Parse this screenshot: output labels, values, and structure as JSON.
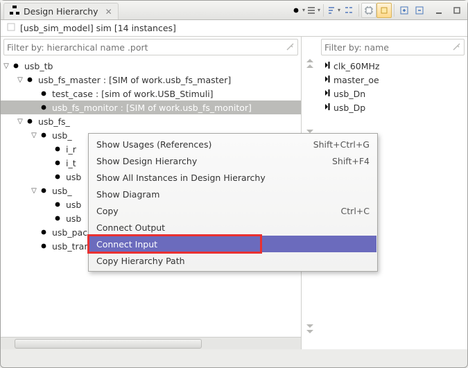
{
  "tab": {
    "title": "Design Hierarchy"
  },
  "crumb": {
    "text": "[usb_sim_model] sim [14 instances]"
  },
  "left_filter": {
    "placeholder": "Filter by: hierarchical name .port"
  },
  "right_filter": {
    "placeholder": "Filter by: name"
  },
  "tree": {
    "items": [
      {
        "indent": 0,
        "expanded": true,
        "kind": "component",
        "label": "usb_tb"
      },
      {
        "indent": 1,
        "expanded": true,
        "kind": "component-o",
        "label": "usb_fs_master : [SIM of work.usb_fs_master]"
      },
      {
        "indent": 2,
        "expanded": false,
        "kind": "component-o",
        "label": "test_case : [sim of work.USB_Stimuli]",
        "leaf": true
      },
      {
        "indent": 2,
        "expanded": false,
        "kind": "component-o",
        "label": "usb_fs_monitor : [SIM of work.usb_fs_monitor]",
        "leaf": true,
        "selected": true
      },
      {
        "indent": 1,
        "expanded": true,
        "kind": "component-o",
        "label": "usb_fs_"
      },
      {
        "indent": 2,
        "expanded": true,
        "kind": "component-o",
        "label": "usb_"
      },
      {
        "indent": 3,
        "expanded": false,
        "kind": "component",
        "label": "i_r",
        "leaf": true
      },
      {
        "indent": 3,
        "expanded": false,
        "kind": "component",
        "label": "i_t",
        "leaf": true
      },
      {
        "indent": 3,
        "expanded": false,
        "kind": "component",
        "label": "usb",
        "leaf": true
      },
      {
        "indent": 2,
        "expanded": true,
        "kind": "component-o",
        "label": "usb_"
      },
      {
        "indent": 3,
        "expanded": false,
        "kind": "component-o",
        "label": "usb",
        "leaf": true
      },
      {
        "indent": 3,
        "expanded": false,
        "kind": "component-o",
        "label": "usb",
        "leaf": true
      },
      {
        "indent": 2,
        "expanded": false,
        "kind": "component-o",
        "label": "usb_packet_inst : [usb_packet_arch of work.u",
        "leaf": true
      },
      {
        "indent": 2,
        "expanded": false,
        "kind": "component-o",
        "label": "usb_transact_inst : [usb_transact_arch of wor",
        "leaf": true
      }
    ]
  },
  "signals": {
    "items": [
      {
        "label": "clk_60MHz"
      },
      {
        "label": "master_oe"
      },
      {
        "label": "usb_Dn"
      },
      {
        "label": "usb_Dp"
      }
    ]
  },
  "menu": {
    "items": [
      {
        "label": "Show Usages (References)",
        "shortcut": "Shift+Ctrl+G"
      },
      {
        "label": "Show Design Hierarchy",
        "shortcut": "Shift+F4"
      },
      {
        "label": "Show All Instances in Design Hierarchy",
        "shortcut": ""
      },
      {
        "label": "Show Diagram",
        "shortcut": ""
      },
      {
        "label": "Copy",
        "shortcut": "Ctrl+C"
      },
      {
        "label": "Connect Output",
        "shortcut": ""
      },
      {
        "label": "Connect Input",
        "shortcut": "",
        "hl": true
      },
      {
        "label": "Copy Hierarchy Path",
        "shortcut": ""
      }
    ]
  }
}
